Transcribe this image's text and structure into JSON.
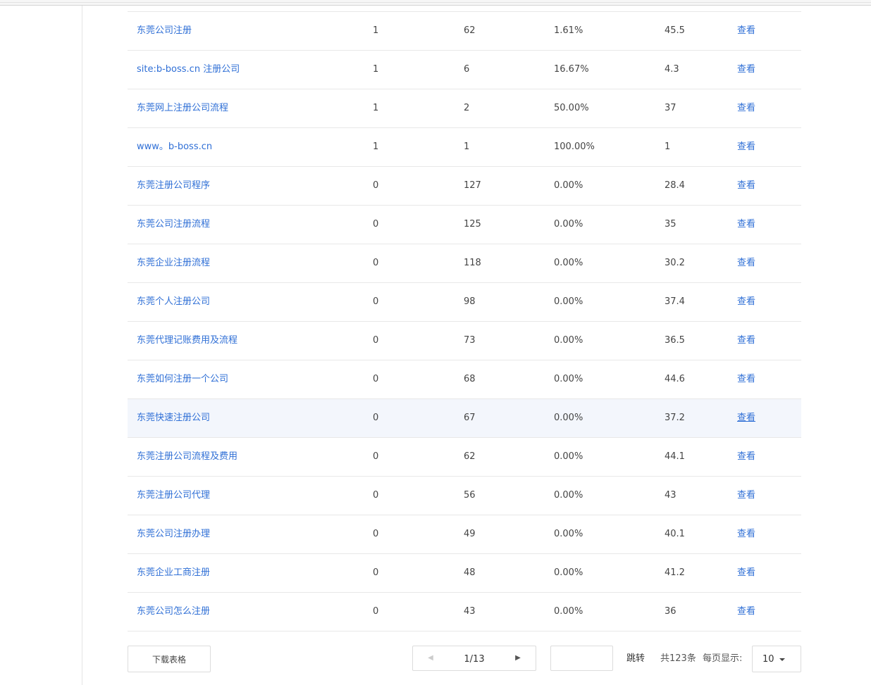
{
  "table": {
    "rows": [
      {
        "keyword": "东莞公司注册",
        "c1": "1",
        "c2": "62",
        "c3": "1.61%",
        "c4": "45.5",
        "action": "查看"
      },
      {
        "keyword": "site:b-boss.cn 注册公司",
        "c1": "1",
        "c2": "6",
        "c3": "16.67%",
        "c4": "4.3",
        "action": "查看"
      },
      {
        "keyword": "东莞网上注册公司流程",
        "c1": "1",
        "c2": "2",
        "c3": "50.00%",
        "c4": "37",
        "action": "查看"
      },
      {
        "keyword": "www。b-boss.cn",
        "c1": "1",
        "c2": "1",
        "c3": "100.00%",
        "c4": "1",
        "action": "查看"
      },
      {
        "keyword": "东莞注册公司程序",
        "c1": "0",
        "c2": "127",
        "c3": "0.00%",
        "c4": "28.4",
        "action": "查看"
      },
      {
        "keyword": "东莞公司注册流程",
        "c1": "0",
        "c2": "125",
        "c3": "0.00%",
        "c4": "35",
        "action": "查看"
      },
      {
        "keyword": "东莞企业注册流程",
        "c1": "0",
        "c2": "118",
        "c3": "0.00%",
        "c4": "30.2",
        "action": "查看"
      },
      {
        "keyword": "东莞个人注册公司",
        "c1": "0",
        "c2": "98",
        "c3": "0.00%",
        "c4": "37.4",
        "action": "查看"
      },
      {
        "keyword": "东莞代理记账费用及流程",
        "c1": "0",
        "c2": "73",
        "c3": "0.00%",
        "c4": "36.5",
        "action": "查看"
      },
      {
        "keyword": "东莞如何注册一个公司",
        "c1": "0",
        "c2": "68",
        "c3": "0.00%",
        "c4": "44.6",
        "action": "查看"
      },
      {
        "keyword": "东莞快速注册公司",
        "c1": "0",
        "c2": "67",
        "c3": "0.00%",
        "c4": "37.2",
        "action": "查看"
      },
      {
        "keyword": "东莞注册公司流程及费用",
        "c1": "0",
        "c2": "62",
        "c3": "0.00%",
        "c4": "44.1",
        "action": "查看"
      },
      {
        "keyword": "东莞注册公司代理",
        "c1": "0",
        "c2": "56",
        "c3": "0.00%",
        "c4": "43",
        "action": "查看"
      },
      {
        "keyword": "东莞公司注册办理",
        "c1": "0",
        "c2": "49",
        "c3": "0.00%",
        "c4": "40.1",
        "action": "查看"
      },
      {
        "keyword": "东莞企业工商注册",
        "c1": "0",
        "c2": "48",
        "c3": "0.00%",
        "c4": "41.2",
        "action": "查看"
      },
      {
        "keyword": "东莞公司怎么注册",
        "c1": "0",
        "c2": "43",
        "c3": "0.00%",
        "c4": "36",
        "action": "查看"
      }
    ],
    "hovered_row_index": 10
  },
  "footer": {
    "download_label": "下载表格",
    "page_info": "1/13",
    "prev_icon": "chevron-left-icon",
    "next_icon": "chevron-right-icon",
    "jump_input_value": "",
    "jump_label": "跳转",
    "total_label": "共123条",
    "per_page_label": "每页显示:",
    "per_page_value": "10"
  },
  "colors": {
    "link": "#2f6fd6",
    "hover_row_bg": "#f3f6fc",
    "border": "#e8e8e8"
  }
}
